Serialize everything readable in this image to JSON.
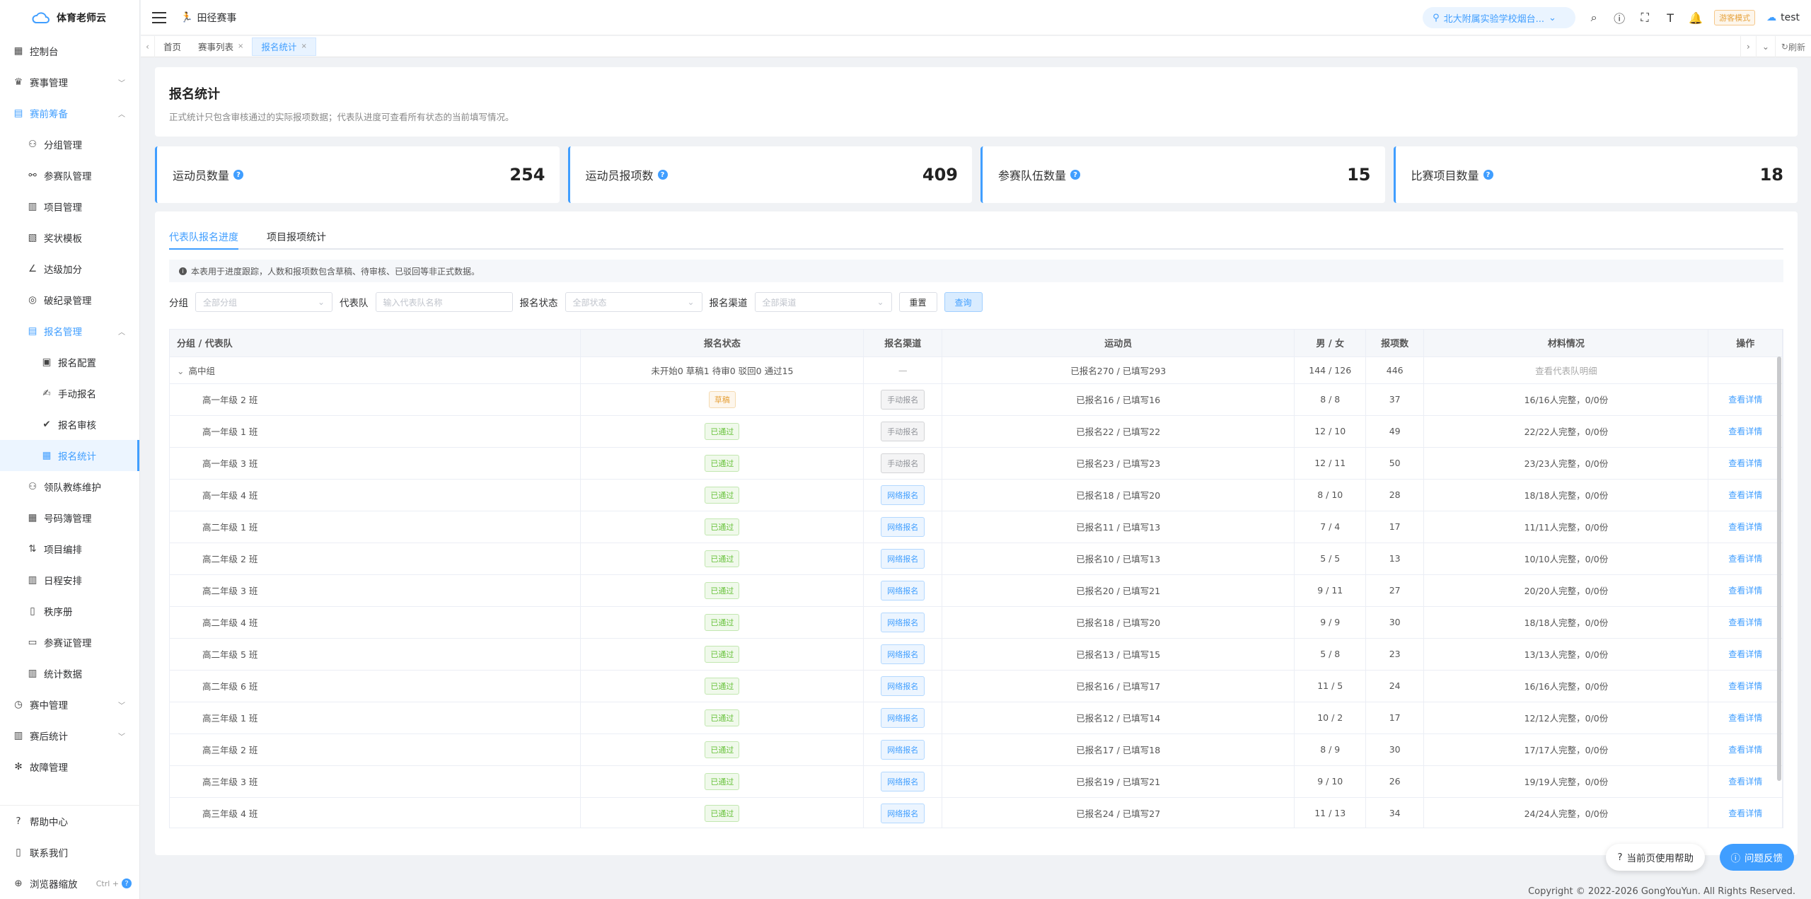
{
  "app": {
    "logo_text": "体育老师云"
  },
  "sidebar": {
    "items": [
      {
        "label": "控制台",
        "icon": "dashboard-icon"
      },
      {
        "label": "赛事管理",
        "icon": "trophy-icon"
      },
      {
        "label": "赛前筹备",
        "icon": "clipboard-icon"
      },
      {
        "label": "分组管理",
        "icon": "group-icon"
      },
      {
        "label": "参赛队管理",
        "icon": "team-icon"
      },
      {
        "label": "项目管理",
        "icon": "project-icon"
      },
      {
        "label": "奖状模板",
        "icon": "certificate-icon"
      },
      {
        "label": "达级加分",
        "icon": "level-icon"
      },
      {
        "label": "破纪录管理",
        "icon": "record-icon"
      },
      {
        "label": "报名管理",
        "icon": "signup-icon"
      },
      {
        "label": "报名配置",
        "icon": "config-icon"
      },
      {
        "label": "手动报名",
        "icon": "manual-icon"
      },
      {
        "label": "报名审核",
        "icon": "audit-icon"
      },
      {
        "label": "报名统计",
        "icon": "stats-icon"
      },
      {
        "label": "领队教练维护",
        "icon": "coach-icon"
      },
      {
        "label": "号码簿管理",
        "icon": "bib-icon"
      },
      {
        "label": "项目编排",
        "icon": "arrange-icon"
      },
      {
        "label": "日程安排",
        "icon": "calendar-icon"
      },
      {
        "label": "秩序册",
        "icon": "book-icon"
      },
      {
        "label": "参赛证管理",
        "icon": "badge-icon"
      },
      {
        "label": "统计数据",
        "icon": "chart-icon"
      },
      {
        "label": "赛中管理",
        "icon": "live-icon"
      },
      {
        "label": "赛后统计",
        "icon": "post-chart-icon"
      },
      {
        "label": "故障管理",
        "icon": "fault-icon"
      }
    ],
    "bottom": [
      {
        "label": "帮助中心"
      },
      {
        "label": "联系我们"
      },
      {
        "label": "浏览器缩放",
        "shortcut": "Ctrl +"
      }
    ]
  },
  "topbar": {
    "breadcrumb": "田径赛事",
    "school": "北大附属实验学校烟台...",
    "visitor_mode": "游客模式",
    "user": "test"
  },
  "tabs": [
    {
      "label": "首页"
    },
    {
      "label": "赛事列表"
    },
    {
      "label": "报名统计"
    }
  ],
  "refresh_label": "刷新",
  "page": {
    "title": "报名统计",
    "desc": "正式统计只包含审核通过的实际报项数据；代表队进度可查看所有状态的当前填写情况。"
  },
  "stats": [
    {
      "label": "运动员数量",
      "value": "254"
    },
    {
      "label": "运动员报项数",
      "value": "409"
    },
    {
      "label": "参赛队伍数量",
      "value": "15"
    },
    {
      "label": "比赛项目数量",
      "value": "18"
    }
  ],
  "subtabs": [
    "代表队报名进度",
    "项目报项统计"
  ],
  "notice": "本表用于进度跟踪，人数和报项数包含草稿、待审核、已驳回等非正式数据。",
  "filters": {
    "group_label": "分组",
    "group_ph": "全部分组",
    "team_label": "代表队",
    "team_ph": "输入代表队名称",
    "status_label": "报名状态",
    "status_ph": "全部状态",
    "channel_label": "报名渠道",
    "channel_ph": "全部渠道",
    "reset": "重置",
    "query": "查询"
  },
  "table": {
    "headers": [
      "分组 / 代表队",
      "报名状态",
      "报名渠道",
      "运动员",
      "男 / 女",
      "报项数",
      "材料情况",
      "操作"
    ],
    "group": {
      "name": "高中组",
      "status": "未开始0 草稿1 待审0 驳回0 通过15",
      "channel": "—",
      "athletes": "已报名270 / 已填写293",
      "gender": "144 / 126",
      "count": "446",
      "material": "查看代表队明细"
    },
    "rows": [
      {
        "team": "高一年级 2 班",
        "status": "草稿",
        "st": "draft",
        "channel": "手动报名",
        "ch": "manual",
        "athletes": "已报名16 / 已填写16",
        "gender": "8 / 8",
        "count": "37",
        "material": "16/16人完整，0/0份",
        "action": "查看详情"
      },
      {
        "team": "高一年级 1 班",
        "status": "已通过",
        "st": "pass",
        "channel": "手动报名",
        "ch": "manual",
        "athletes": "已报名22 / 已填写22",
        "gender": "12 / 10",
        "count": "49",
        "material": "22/22人完整，0/0份",
        "action": "查看详情"
      },
      {
        "team": "高一年级 3 班",
        "status": "已通过",
        "st": "pass",
        "channel": "手动报名",
        "ch": "manual",
        "athletes": "已报名23 / 已填写23",
        "gender": "12 / 11",
        "count": "50",
        "material": "23/23人完整，0/0份",
        "action": "查看详情"
      },
      {
        "team": "高一年级 4 班",
        "status": "已通过",
        "st": "pass",
        "channel": "网络报名",
        "ch": "net",
        "athletes": "已报名18 / 已填写20",
        "gender": "8 / 10",
        "count": "28",
        "material": "18/18人完整，0/0份",
        "action": "查看详情"
      },
      {
        "team": "高二年级 1 班",
        "status": "已通过",
        "st": "pass",
        "channel": "网络报名",
        "ch": "net",
        "athletes": "已报名11 / 已填写13",
        "gender": "7 / 4",
        "count": "17",
        "material": "11/11人完整，0/0份",
        "action": "查看详情"
      },
      {
        "team": "高二年级 2 班",
        "status": "已通过",
        "st": "pass",
        "channel": "网络报名",
        "ch": "net",
        "athletes": "已报名10 / 已填写13",
        "gender": "5 / 5",
        "count": "13",
        "material": "10/10人完整，0/0份",
        "action": "查看详情"
      },
      {
        "team": "高二年级 3 班",
        "status": "已通过",
        "st": "pass",
        "channel": "网络报名",
        "ch": "net",
        "athletes": "已报名20 / 已填写21",
        "gender": "9 / 11",
        "count": "27",
        "material": "20/20人完整，0/0份",
        "action": "查看详情"
      },
      {
        "team": "高二年级 4 班",
        "status": "已通过",
        "st": "pass",
        "channel": "网络报名",
        "ch": "net",
        "athletes": "已报名18 / 已填写20",
        "gender": "9 / 9",
        "count": "30",
        "material": "18/18人完整，0/0份",
        "action": "查看详情"
      },
      {
        "team": "高二年级 5 班",
        "status": "已通过",
        "st": "pass",
        "channel": "网络报名",
        "ch": "net",
        "athletes": "已报名13 / 已填写15",
        "gender": "5 / 8",
        "count": "23",
        "material": "13/13人完整，0/0份",
        "action": "查看详情"
      },
      {
        "team": "高二年级 6 班",
        "status": "已通过",
        "st": "pass",
        "channel": "网络报名",
        "ch": "net",
        "athletes": "已报名16 / 已填写17",
        "gender": "11 / 5",
        "count": "24",
        "material": "16/16人完整，0/0份",
        "action": "查看详情"
      },
      {
        "team": "高三年级 1 班",
        "status": "已通过",
        "st": "pass",
        "channel": "网络报名",
        "ch": "net",
        "athletes": "已报名12 / 已填写14",
        "gender": "10 / 2",
        "count": "17",
        "material": "12/12人完整，0/0份",
        "action": "查看详情"
      },
      {
        "team": "高三年级 2 班",
        "status": "已通过",
        "st": "pass",
        "channel": "网络报名",
        "ch": "net",
        "athletes": "已报名17 / 已填写18",
        "gender": "8 / 9",
        "count": "30",
        "material": "17/17人完整，0/0份",
        "action": "查看详情"
      },
      {
        "team": "高三年级 3 班",
        "status": "已通过",
        "st": "pass",
        "channel": "网络报名",
        "ch": "net",
        "athletes": "已报名19 / 已填写21",
        "gender": "9 / 10",
        "count": "26",
        "material": "19/19人完整，0/0份",
        "action": "查看详情"
      },
      {
        "team": "高三年级 4 班",
        "status": "已通过",
        "st": "pass",
        "channel": "网络报名",
        "ch": "net",
        "athletes": "已报名24 / 已填写27",
        "gender": "11 / 13",
        "count": "34",
        "material": "24/24人完整，0/0份",
        "action": "查看详情"
      }
    ]
  },
  "float": {
    "help": "当前页使用帮助",
    "feedback": "问题反馈"
  },
  "footer": "Copyright © 2022-2026 GongYouYun. All Rights Reserved."
}
